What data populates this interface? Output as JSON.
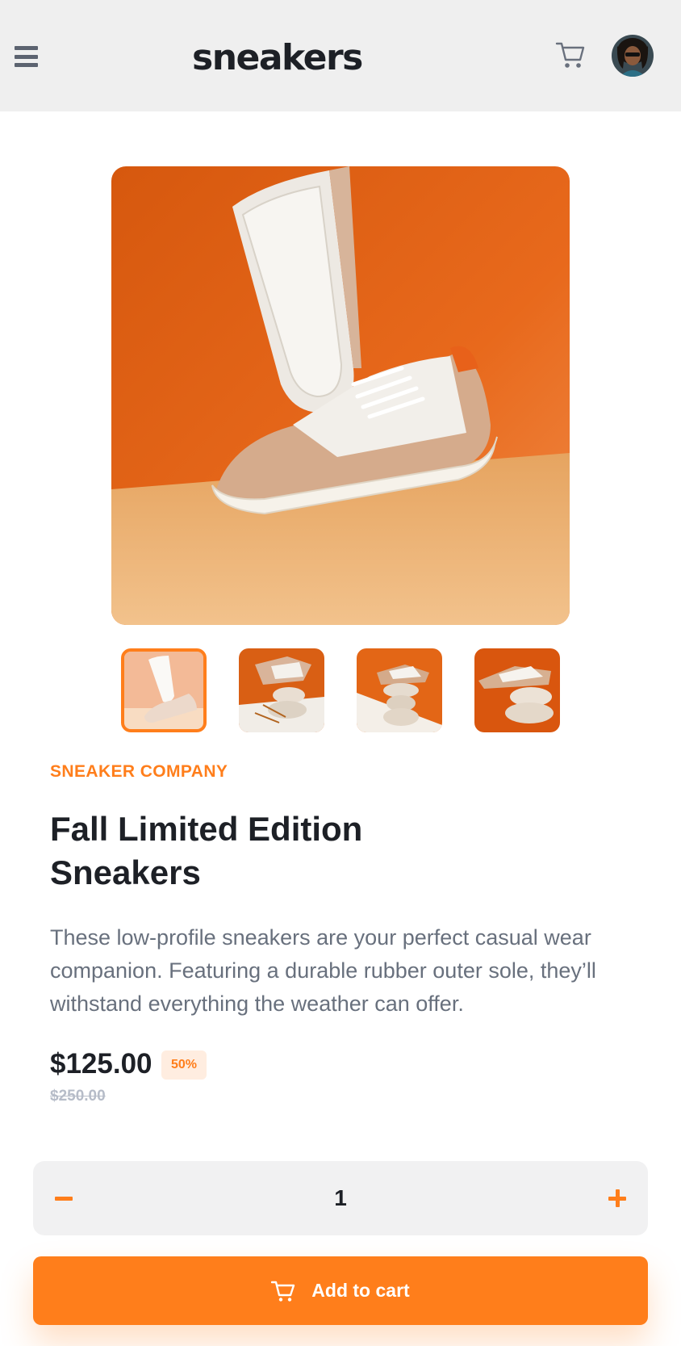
{
  "header": {
    "logo": "sneakers",
    "menu_icon": "hamburger-menu-icon",
    "cart_icon": "cart-icon",
    "avatar_alt": "user-avatar"
  },
  "gallery": {
    "thumbnail_count": 4,
    "active_thumbnail": 1
  },
  "product": {
    "company": "SNEAKER COMPANY",
    "title": "Fall Limited Edition Sneakers",
    "description": "These low-profile sneakers are your perfect casual wear companion. Featuring a durable rubber outer sole, they’ll withstand everything the weather can offer.",
    "price": "$125.00",
    "discount": "50%",
    "original_price": "$250.00"
  },
  "quantity": {
    "value": "1"
  },
  "cart_button": {
    "label": "Add to cart"
  },
  "colors": {
    "accent": "#ff7e1b",
    "dark": "#1d2026",
    "muted": "#68707d",
    "header_bg": "#efefef"
  }
}
